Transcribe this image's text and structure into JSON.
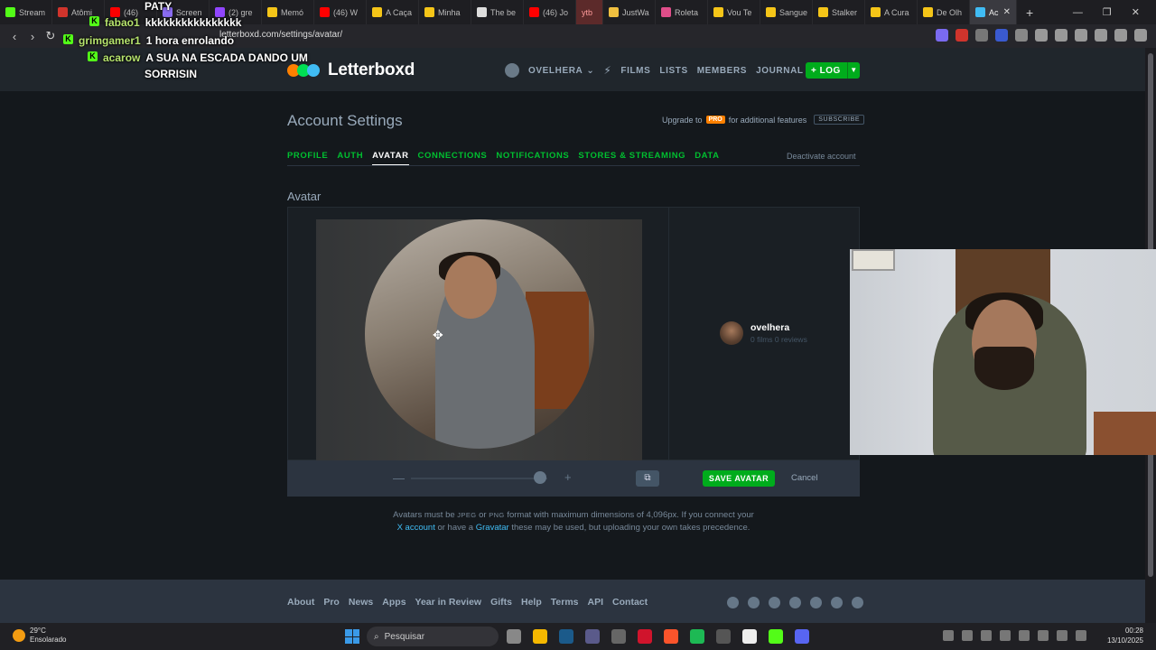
{
  "browser": {
    "tabs": [
      {
        "label": "Stream",
        "color": "#53fc18"
      },
      {
        "label": "Atômi",
        "color": "#d0342c"
      },
      {
        "label": "(46)",
        "color": "#ff0000"
      },
      {
        "label": "Screen",
        "color": "#8a6cf0"
      },
      {
        "label": "(2) gre",
        "color": "#9146ff"
      },
      {
        "label": "Memó",
        "color": "#f5c518"
      },
      {
        "label": "(46) W",
        "color": "#ff0000"
      },
      {
        "label": "A Caça",
        "color": "#f5c518"
      },
      {
        "label": "Minha",
        "color": "#f5c518"
      },
      {
        "label": "The be",
        "color": "#dddddd"
      },
      {
        "label": "(46) Jo",
        "color": "#ff0000"
      },
      {
        "label": "ytb",
        "color": "#5c2a2a"
      },
      {
        "label": "JustWa",
        "color": "#f0c040"
      },
      {
        "label": "Roleta",
        "color": "#e04e8a"
      },
      {
        "label": "Vou Te",
        "color": "#f5c518"
      },
      {
        "label": "Sangue",
        "color": "#f5c518"
      },
      {
        "label": "Stalker",
        "color": "#f5c518"
      },
      {
        "label": "A Cura",
        "color": "#f5c518"
      },
      {
        "label": "De Olh",
        "color": "#f5c518"
      },
      {
        "label": "Ac",
        "color": "#40bcf4"
      }
    ],
    "url": "letterboxd.com/settings/avatar/",
    "new_tab": "+"
  },
  "chat": {
    "top_user": "PATY",
    "messages": [
      {
        "user": "fabao1",
        "text": "kkkkkkkkkkkkkkkk"
      },
      {
        "user": "grimgamer1",
        "text": "1 hora enrolando"
      },
      {
        "user": "acarow",
        "text": "A SUA NA ESCADA DANDO UM",
        "text2": "SORRISIN"
      }
    ]
  },
  "header": {
    "logo_text": "Letterboxd",
    "username": "OVELHERA",
    "nav": [
      "FILMS",
      "LISTS",
      "MEMBERS",
      "JOURNAL"
    ],
    "log_label": "+ LOG"
  },
  "settings": {
    "title": "Account Settings",
    "upgrade_prefix": "Upgrade to",
    "pro_badge": "PRO",
    "upgrade_suffix": "for additional features",
    "subscribe": "SUBSCRIBE",
    "tabs": [
      "PROFILE",
      "AUTH",
      "AVATAR",
      "CONNECTIONS",
      "NOTIFICATIONS",
      "STORES & STREAMING",
      "DATA"
    ],
    "active_tab": "AVATAR",
    "deactivate": "Deactivate account",
    "section_title": "Avatar",
    "profile_name": "ovelhera",
    "profile_stats": "0 films 0 reviews",
    "zoom_level": 0.95,
    "save_label": "SAVE AVATAR",
    "cancel_label": "Cancel",
    "info_1": "Avatars must be",
    "info_jpeg": "JPEG",
    "info_or": "or",
    "info_png": "PNG",
    "info_2": "format with maximum dimensions of 4,096px. If you connect your",
    "info_x": "X account",
    "info_3": "or have a",
    "info_gravatar": "Gravatar",
    "info_4": "these may be used, but uploading your own takes precedence."
  },
  "footer": {
    "links": [
      "About",
      "Pro",
      "News",
      "Apps",
      "Year in Review",
      "Gifts",
      "Help",
      "Terms",
      "API",
      "Contact"
    ]
  },
  "taskbar": {
    "temperature": "29°C",
    "weather": "Ensolarado",
    "search": "Pesquisar",
    "time": "00:28",
    "date": "13/10/2025"
  },
  "colors": {
    "accent_green": "#00ac1c",
    "link_blue": "#40bcf4",
    "dot_orange": "#ff8000",
    "dot_green": "#00e054",
    "dot_blue": "#40bcf4"
  }
}
